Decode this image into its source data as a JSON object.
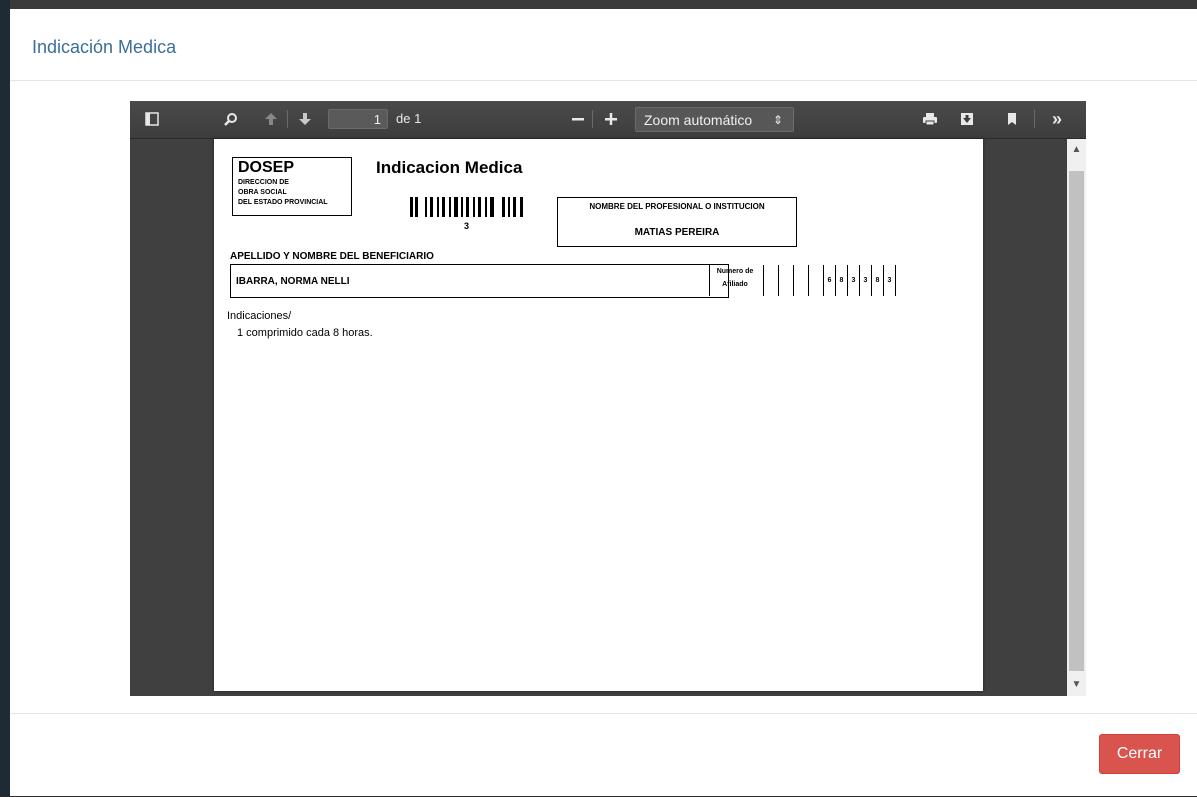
{
  "modal": {
    "title": "Indicación Medica",
    "close_label": "Cerrar"
  },
  "viewer": {
    "page_number": "1",
    "page_count": "de 1",
    "zoom": "Zoom automático",
    "icons": [
      "sidebar-toggle-icon",
      "search-icon",
      "previous-page-icon",
      "next-page-icon",
      "zoom-out-icon",
      "zoom-in-icon",
      "print-icon",
      "download-icon",
      "bookmark-icon",
      "more-tools-icon"
    ]
  },
  "document": {
    "logo_title": "DOSEP",
    "logo_lines": [
      "DIRECCION DE",
      "OBRA SOCIAL",
      "DEL ESTADO PROVINCIAL"
    ],
    "title": "Indicacion Medica",
    "barcode_number": "3",
    "professional_label": "NOMBRE DEL PROFESIONAL O INSTITUCION",
    "professional_name": "MATIAS PEREIRA",
    "beneficiary_label": "APELLIDO Y NOMBRE DEL BENEFICIARIO",
    "beneficiary_name": "IBARRA, NORMA NELLI",
    "affiliate_label_1": "Numero de",
    "affiliate_label_2": "Afiliado",
    "affiliate_digits": [
      "",
      "",
      "",
      "",
      "6",
      "8",
      "3",
      "3",
      "8",
      "3"
    ],
    "indications_label": "Indicaciones/",
    "indications_text": "1 comprimido cada 8 horas."
  }
}
